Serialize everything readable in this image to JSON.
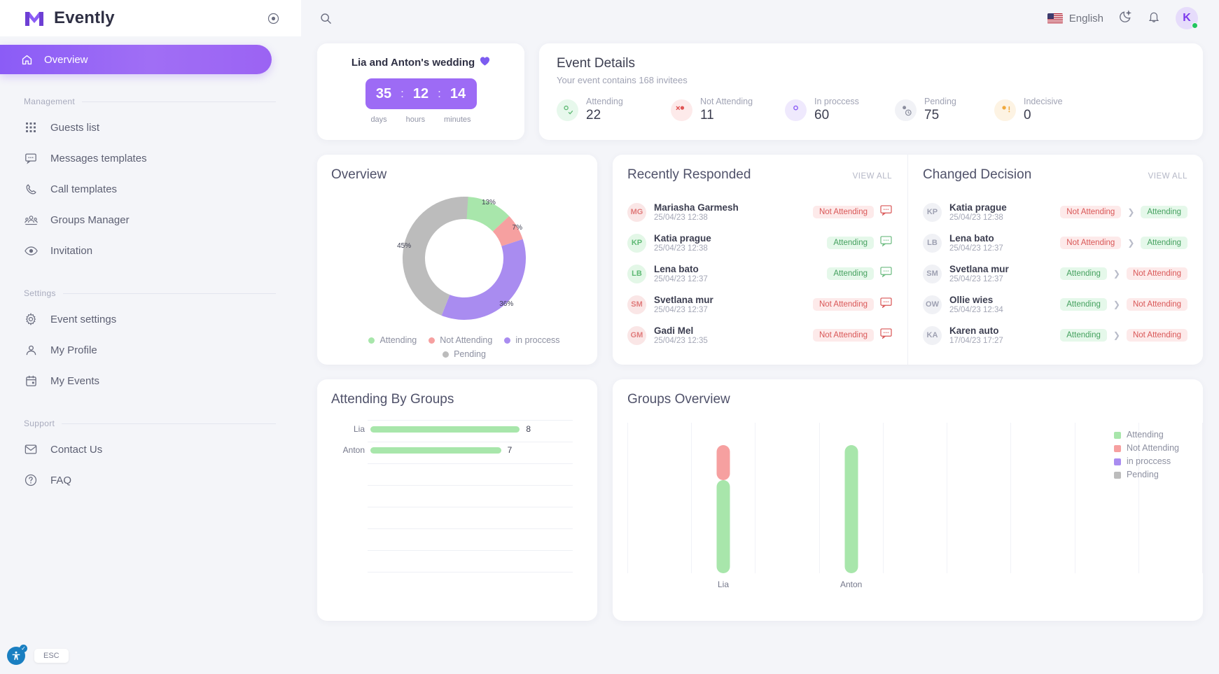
{
  "brand": {
    "name": "Evently",
    "logo_icon": "evently-m-logo",
    "toggle_icon": "collapse-sidebar-icon"
  },
  "sidebar": {
    "active": {
      "label": "Overview",
      "icon": "home-icon"
    },
    "sections": [
      {
        "label": "Management",
        "items": [
          {
            "label": "Guests list",
            "icon": "grid-icon"
          },
          {
            "label": "Messages templates",
            "icon": "message-icon"
          },
          {
            "label": "Call templates",
            "icon": "phone-icon"
          },
          {
            "label": "Groups Manager",
            "icon": "group-icon"
          },
          {
            "label": "Invitation",
            "icon": "eye-icon"
          }
        ]
      },
      {
        "label": "Settings",
        "items": [
          {
            "label": "Event settings",
            "icon": "gear-icon"
          },
          {
            "label": "My Profile",
            "icon": "user-icon"
          },
          {
            "label": "My Events",
            "icon": "calendar-icon"
          }
        ]
      },
      {
        "label": "Support",
        "items": [
          {
            "label": "Contact Us",
            "icon": "mail-icon"
          },
          {
            "label": "FAQ",
            "icon": "question-circle-icon"
          }
        ]
      }
    ],
    "accessibility": {
      "icon": "accessibility-icon",
      "esc_label": "ESC"
    }
  },
  "topbar": {
    "search_icon": "search-icon",
    "language": "English",
    "flag_icon": "us-flag-icon",
    "theme_icon": "dark-mode-icon",
    "notifications_icon": "bell-icon",
    "avatar_initial": "K"
  },
  "countdown": {
    "title": "Lia and Anton's wedding",
    "heart_icon": "purple-heart-icon",
    "days": "35",
    "hours": "12",
    "minutes": "14",
    "sep": ":",
    "unit_days": "days",
    "unit_hours": "hours",
    "unit_minutes": "minutes"
  },
  "event_details": {
    "title": "Event Details",
    "subtitle": "Your event contains 168 invitees",
    "stats": [
      {
        "label": "Attending",
        "value": "22",
        "icon": "user-check-icon",
        "color": "#5fb974",
        "bg": "#e7f8ec"
      },
      {
        "label": "Not Attending",
        "value": "11",
        "icon": "user-x-icon",
        "color": "#e05555",
        "bg": "#fdeaea"
      },
      {
        "label": "In proccess",
        "value": "60",
        "icon": "user-icon",
        "color": "#8b5cf6",
        "bg": "#efe9fd"
      },
      {
        "label": "Pending",
        "value": "75",
        "icon": "user-clock-icon",
        "color": "#8b8e9e",
        "bg": "#f1f2f6"
      },
      {
        "label": "Indecisive",
        "value": "0",
        "icon": "user-alert-icon",
        "color": "#f0a93c",
        "bg": "#fdf3e3"
      }
    ]
  },
  "overview": {
    "title": "Overview",
    "legend": [
      "Attending",
      "Not Attending",
      "in proccess",
      "Pending"
    ]
  },
  "recently_responded": {
    "title": "Recently Responded",
    "view_all": "VIEW ALL",
    "rows": [
      {
        "initials": "MG",
        "tone": "red",
        "name": "Mariasha Garmesh",
        "date": "25/04/23 12:38",
        "status": "Not Attending",
        "status_type": "nat",
        "comment_icon": "comment-icon"
      },
      {
        "initials": "KP",
        "tone": "green",
        "name": "Katia prague",
        "date": "25/04/23 12:38",
        "status": "Attending",
        "status_type": "att",
        "comment_icon": "comment-icon"
      },
      {
        "initials": "LB",
        "tone": "green",
        "name": "Lena bato",
        "date": "25/04/23 12:37",
        "status": "Attending",
        "status_type": "att",
        "comment_icon": "comment-icon"
      },
      {
        "initials": "SM",
        "tone": "red",
        "name": "Svetlana mur",
        "date": "25/04/23 12:37",
        "status": "Not Attending",
        "status_type": "nat",
        "comment_icon": "comment-icon"
      },
      {
        "initials": "GM",
        "tone": "red",
        "name": "Gadi Mel",
        "date": "25/04/23 12:35",
        "status": "Not Attending",
        "status_type": "nat",
        "comment_icon": "comment-icon"
      }
    ]
  },
  "changed_decision": {
    "title": "Changed Decision",
    "view_all": "VIEW ALL",
    "arrow_icon": "chevron-right-icon",
    "rows": [
      {
        "initials": "KP",
        "name": "Katia prague",
        "date": "25/04/23 12:38",
        "from": "Not Attending",
        "from_type": "nat",
        "to": "Attending",
        "to_type": "att"
      },
      {
        "initials": "LB",
        "name": "Lena bato",
        "date": "25/04/23 12:37",
        "from": "Not Attending",
        "from_type": "nat",
        "to": "Attending",
        "to_type": "att"
      },
      {
        "initials": "SM",
        "name": "Svetlana mur",
        "date": "25/04/23 12:37",
        "from": "Attending",
        "from_type": "att",
        "to": "Not Attending",
        "to_type": "nat"
      },
      {
        "initials": "OW",
        "name": "Ollie wies",
        "date": "25/04/23 12:34",
        "from": "Attending",
        "from_type": "att",
        "to": "Not Attending",
        "to_type": "nat"
      },
      {
        "initials": "KA",
        "name": "Karen auto",
        "date": "17/04/23 17:27",
        "from": "Attending",
        "from_type": "att",
        "to": "Not Attending",
        "to_type": "nat"
      }
    ]
  },
  "attending_by_groups": {
    "title": "Attending By Groups"
  },
  "groups_overview": {
    "title": "Groups Overview",
    "legend": [
      "Attending",
      "Not Attending",
      "in proccess",
      "Pending"
    ]
  },
  "colors": {
    "attending": "#a8e6ab",
    "not_attending": "#f6a0a0",
    "in_proccess": "#a98cf0",
    "pending": "#bcbcbc",
    "accent": "#8b5cf6"
  },
  "chart_data": [
    {
      "type": "pie",
      "title": "Overview",
      "labels": [
        "Attending",
        "Not Attending",
        "in proccess",
        "Pending"
      ],
      "values": [
        13,
        7,
        36,
        45
      ],
      "value_labels": [
        "13%",
        "7%",
        "36%",
        "45%"
      ],
      "colors": [
        "#a8e6ab",
        "#f6a0a0",
        "#a98cf0",
        "#bcbcbc"
      ],
      "donut": true,
      "legend": "bottom"
    },
    {
      "type": "bar",
      "orientation": "horizontal",
      "title": "Attending By Groups",
      "categories": [
        "Lia",
        "Anton"
      ],
      "values": [
        8,
        7
      ],
      "value_labels": [
        "8",
        "7"
      ],
      "color": "#a8e6ab",
      "xlim": [
        0,
        9
      ],
      "grid": true,
      "xlabel": "",
      "ylabel": ""
    },
    {
      "type": "bar",
      "stacked": true,
      "title": "Groups Overview",
      "categories": [
        "Lia",
        "Anton"
      ],
      "series": [
        {
          "name": "Attending",
          "values": [
            8,
            11
          ],
          "color": "#a8e6ab"
        },
        {
          "name": "Not Attending",
          "values": [
            3,
            0
          ],
          "color": "#f6a0a0"
        },
        {
          "name": "in proccess",
          "values": [
            0,
            0
          ],
          "color": "#a98cf0"
        },
        {
          "name": "Pending",
          "values": [
            0,
            0
          ],
          "color": "#bcbcbc"
        }
      ],
      "ylim": [
        0,
        12
      ],
      "grid": true,
      "legend": "right",
      "xlabel": "",
      "ylabel": ""
    }
  ]
}
